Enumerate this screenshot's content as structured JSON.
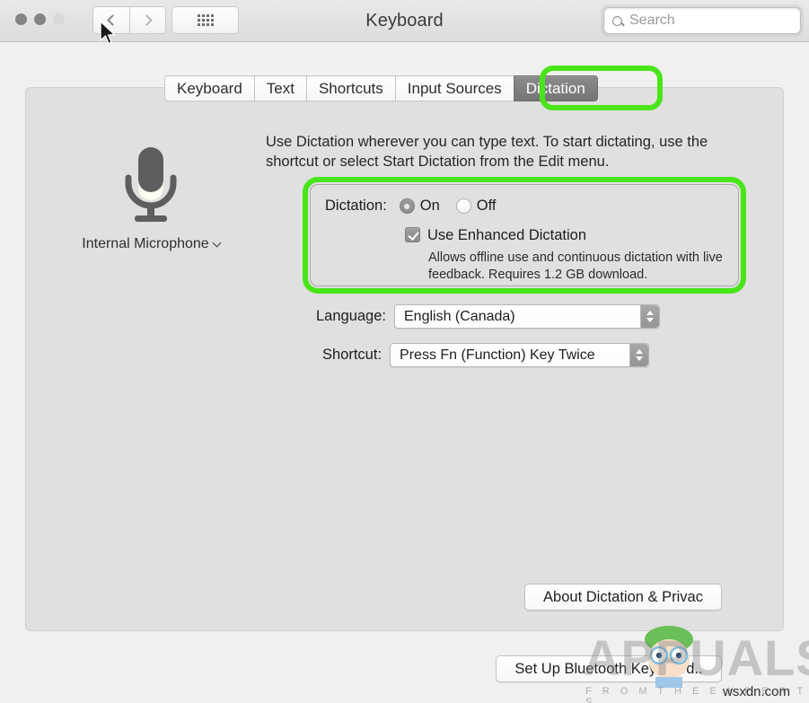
{
  "window": {
    "title": "Keyboard",
    "traffic_lights": [
      "close-button",
      "minimize-button",
      "zoom-button"
    ],
    "back_icon": "chevron-left-icon",
    "forward_icon": "chevron-right-icon",
    "show_all_icon": "grid-icon",
    "cursor_icon": "mouse-pointer-icon"
  },
  "search": {
    "placeholder": "Search",
    "value": "",
    "icon": "search-icon"
  },
  "tabs": [
    {
      "label": "Keyboard",
      "selected": false
    },
    {
      "label": "Text",
      "selected": false
    },
    {
      "label": "Shortcuts",
      "selected": false
    },
    {
      "label": "Input Sources",
      "selected": false
    },
    {
      "label": "Dictation",
      "selected": true
    }
  ],
  "main": {
    "microphone": {
      "icon": "microphone-icon",
      "label": "Internal Microphone",
      "chevron_icon": "chevron-down-icon"
    },
    "intro_text": "Use Dictation wherever you can type text. To start dictating, use the shortcut or select Start Dictation from the Edit menu.",
    "dictation": {
      "label": "Dictation:",
      "options": [
        {
          "label": "On",
          "selected": true
        },
        {
          "label": "Off",
          "selected": false
        }
      ],
      "enhanced": {
        "label": "Use Enhanced Dictation",
        "checked": true,
        "help": "Allows offline use and continuous dictation with live feedback. Requires 1.2 GB download."
      }
    },
    "language": {
      "label": "Language:",
      "value": "English (Canada)",
      "stepper_icon": "stepper-arrows-icon"
    },
    "shortcut": {
      "label": "Shortcut:",
      "value": "Press Fn (Function) Key Twice",
      "stepper_icon": "stepper-arrows-icon"
    },
    "about_button": "About Dictation & Privac"
  },
  "footer": {
    "bluetooth_button": "Set Up Bluetooth Keyboard.."
  },
  "watermark": {
    "brand": "APPUALS",
    "tagline": "F R O M   T H E   E X P E R T S",
    "site": "wsxdn.com"
  },
  "highlights": {
    "color": "#49e51a",
    "regions": [
      "dictation-tab",
      "dictation-settings-group"
    ]
  }
}
